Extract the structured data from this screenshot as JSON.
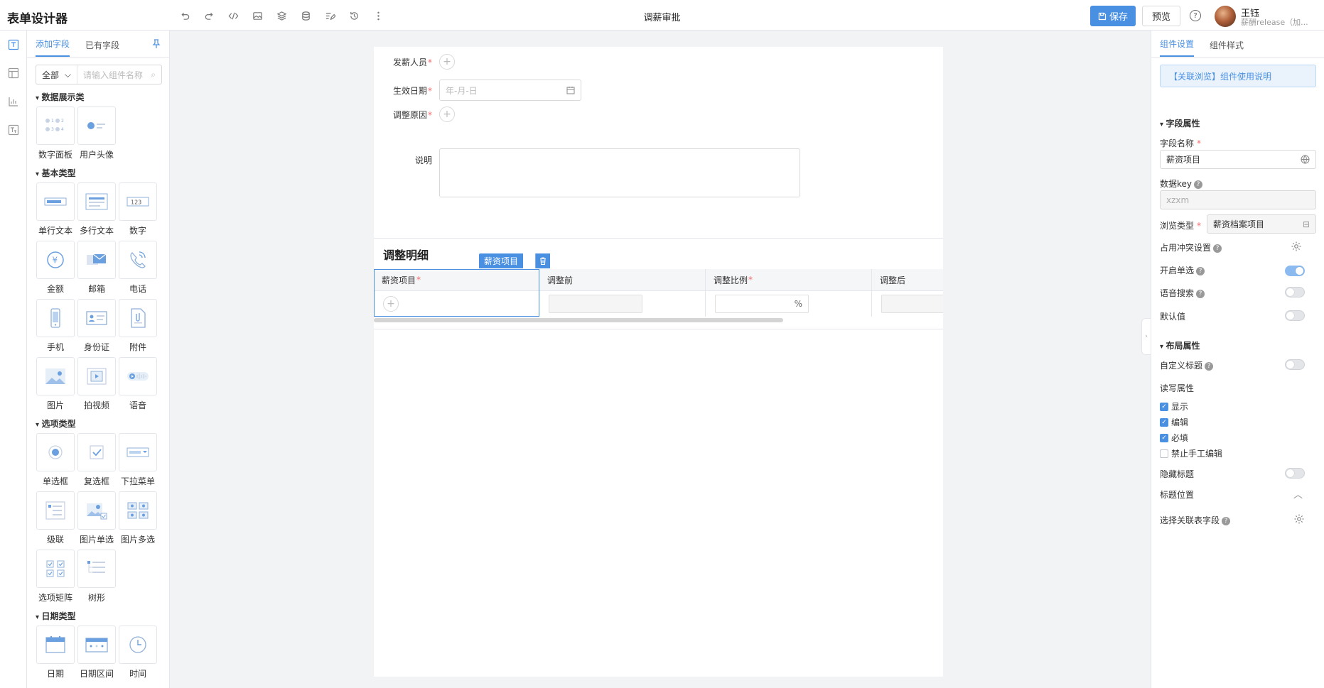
{
  "app": {
    "title": "表单设计器",
    "form_title": "调薪审批"
  },
  "header": {
    "save_label": "保存",
    "preview_label": "预览",
    "help": "?",
    "user_name": "王钰",
    "user_sub": "薪酬release（加..."
  },
  "left": {
    "tabs": [
      "添加字段",
      "已有字段"
    ],
    "filter_select": "全部",
    "search_placeholder": "请输入组件名称",
    "groups": [
      {
        "title": "数据展示类",
        "items": [
          "数字面板",
          "用户头像"
        ]
      },
      {
        "title": "基本类型",
        "items": [
          "单行文本",
          "多行文本",
          "数字",
          "金额",
          "邮箱",
          "电话",
          "手机",
          "身份证",
          "附件",
          "图片",
          "拍视频",
          "语音"
        ]
      },
      {
        "title": "选项类型",
        "items": [
          "单选框",
          "复选框",
          "下拉菜单",
          "级联",
          "图片单选",
          "图片多选",
          "选项矩阵",
          "树形"
        ]
      },
      {
        "title": "日期类型",
        "items": [
          "日期",
          "日期区间",
          "时间"
        ]
      }
    ]
  },
  "form": {
    "fields": [
      {
        "label": "发薪人员",
        "required": "*"
      },
      {
        "label": "生效日期",
        "required": "*",
        "placeholder": "年-月-日"
      },
      {
        "label": "调整原因",
        "required": "*"
      },
      {
        "label": "说明",
        "required": ""
      }
    ],
    "detail": {
      "title": "调整明细",
      "selected_tag": "薪资项目",
      "columns": [
        {
          "label": "薪资项目",
          "required": "*"
        },
        {
          "label": "调整前",
          "required": ""
        },
        {
          "label": "调整比例",
          "required": "*"
        },
        {
          "label": "调整后",
          "required": ""
        }
      ],
      "percent": "%"
    }
  },
  "right": {
    "tabs": [
      "组件设置",
      "组件样式"
    ],
    "info_link": "【关联浏览】组件使用说明",
    "sections": {
      "field": "字段属性",
      "layout": "布局属性"
    },
    "field_name_label": "字段名称",
    "field_name_value": "薪资项目",
    "data_key_label": "数据key",
    "data_key_value": "xzxm",
    "browse_type_label": "浏览类型",
    "browse_type_value": "薪资档案项目",
    "conflict_label": "占用冲突设置",
    "single_label": "开启单选",
    "voice_label": "语音搜索",
    "default_label": "默认值",
    "custom_title_label": "自定义标题",
    "rw_label": "读写属性",
    "checkboxes": [
      {
        "label": "显示",
        "checked": true
      },
      {
        "label": "编辑",
        "checked": true
      },
      {
        "label": "必填",
        "checked": true
      },
      {
        "label": "禁止手工编辑",
        "checked": false
      }
    ],
    "hide_title_label": "隐藏标题",
    "title_pos_label": "标题位置",
    "related_field_label": "选择关联表字段",
    "toggles": {
      "single": true,
      "voice": false,
      "default": false,
      "custom_title": false,
      "hide_title": false
    }
  },
  "colors": {
    "accent": "#4a90e2",
    "required": "#f56c6c"
  },
  "icons": {
    "save": "save-icon",
    "search": "search-icon",
    "calendar": "calendar-icon",
    "gear": "gear-icon",
    "delete": "trash-icon"
  }
}
